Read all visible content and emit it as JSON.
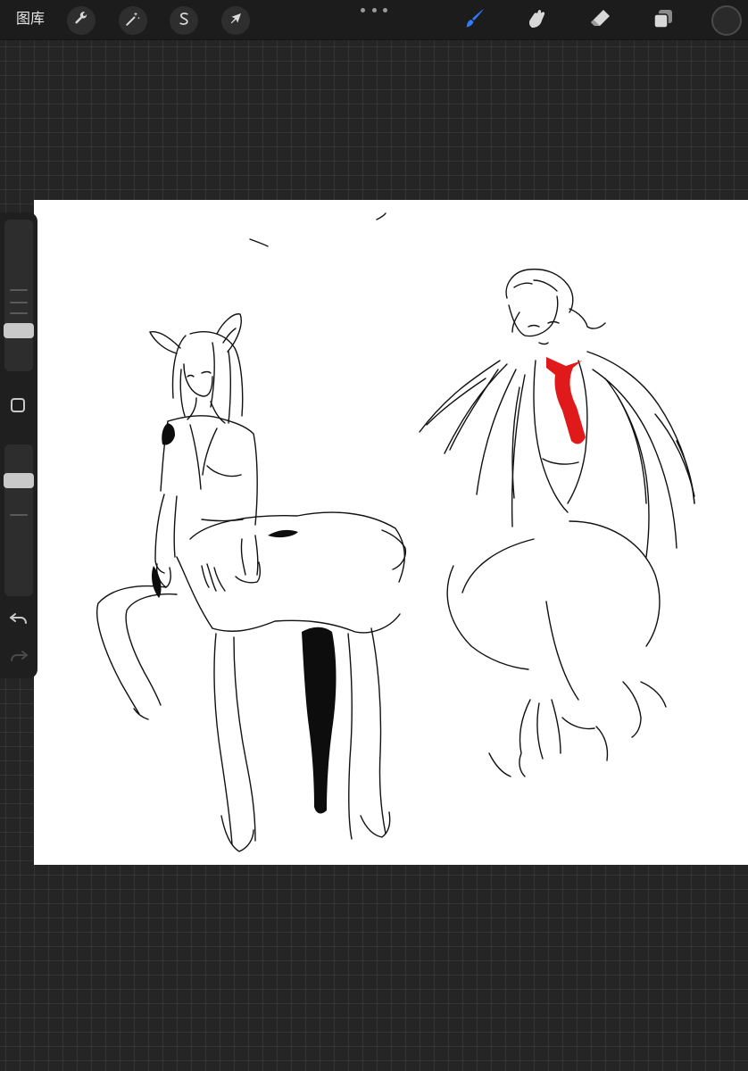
{
  "toolbar": {
    "gallery_label": "图库",
    "left_tools": [
      {
        "name": "actions-icon"
      },
      {
        "name": "adjustments-icon"
      },
      {
        "name": "selection-icon"
      },
      {
        "name": "transform-icon"
      }
    ],
    "right_tools": [
      {
        "name": "brush-icon",
        "active": true
      },
      {
        "name": "smudge-icon"
      },
      {
        "name": "eraser-icon"
      },
      {
        "name": "layers-icon"
      }
    ],
    "current_color": "#2a2a2a",
    "active_color": "#2f7bff"
  },
  "sidebar": {
    "brush_size_level": 0.25,
    "opacity_level": 0.25
  },
  "canvas": {
    "background": "#ffffff",
    "accent_stroke_color": "#e01a1a"
  }
}
